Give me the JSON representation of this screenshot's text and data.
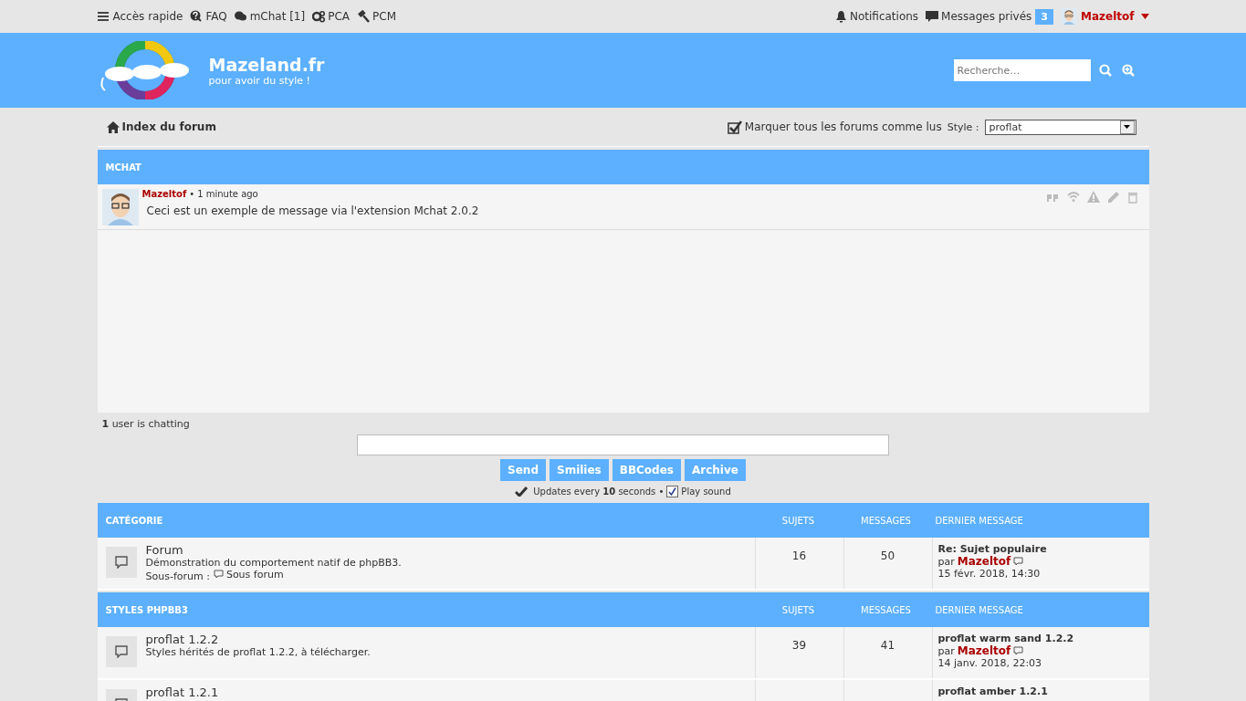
{
  "top_nav": {
    "left": [
      {
        "label": "Accès rapide"
      },
      {
        "label": "FAQ"
      },
      {
        "label": "mChat [1]"
      },
      {
        "label": "PCA"
      },
      {
        "label": "PCM"
      }
    ],
    "notifications": "Notifications",
    "messages": "Messages privés",
    "messages_count": "3",
    "username": "Mazeltof"
  },
  "header": {
    "site_title": "Mazeland.fr",
    "tagline": "pour avoir du style !",
    "search": {
      "placeholder": "Recherche…"
    }
  },
  "breadcrumb": {
    "index": "Index du forum",
    "mark_read": "Marquer tous les forums comme lus",
    "style_label": "Style :",
    "style_value": "proflat"
  },
  "mchat": {
    "title": "MCHAT",
    "messages": [
      {
        "author": "Mazeltof",
        "separator": "•",
        "time": "1 minute ago",
        "text": "Ceci est un exemple de message via l'extension Mchat 2.0.2"
      }
    ],
    "users": "**1** user is chatting",
    "buttons": [
      "Send",
      "Smilies",
      "BBCodes",
      "Archive"
    ],
    "updates": "Updates every **10** seconds •",
    "play_sound": {
      "label": "Play sound",
      "checked": true
    }
  },
  "categories": [
    {
      "title": "CATÉGORIE",
      "columns": [
        "SUJETS",
        "MESSAGES",
        "DERNIER MESSAGE"
      ],
      "forums": [
        {
          "name": "Forum",
          "description": "Démonstration du comportement natif de phpBB3.",
          "subforum_label": "Sous-forum :",
          "subforum": "Sous forum",
          "topics": "16",
          "posts": "50",
          "last_title": "Re: Sujet populaire",
          "last_by": "par",
          "last_author": "Mazeltof",
          "last_date": "15 févr. 2018, 14:30"
        }
      ]
    },
    {
      "title": "STYLES PHPBB3",
      "columns": [
        "SUJETS",
        "MESSAGES",
        "DERNIER MESSAGE"
      ],
      "forums": [
        {
          "name": "proflat 1.2.2",
          "description": "Styles hérités de proflat 1.2.2, à télécharger.",
          "topics": "39",
          "posts": "41",
          "last_title": "proflat warm sand 1.2.2",
          "last_by": "par",
          "last_author": "Mazeltof",
          "last_date": "14 janv. 2018, 22:03"
        },
        {
          "name": "proflat 1.2.1",
          "last_title": "proflat amber 1.2.1"
        }
      ]
    }
  ]
}
